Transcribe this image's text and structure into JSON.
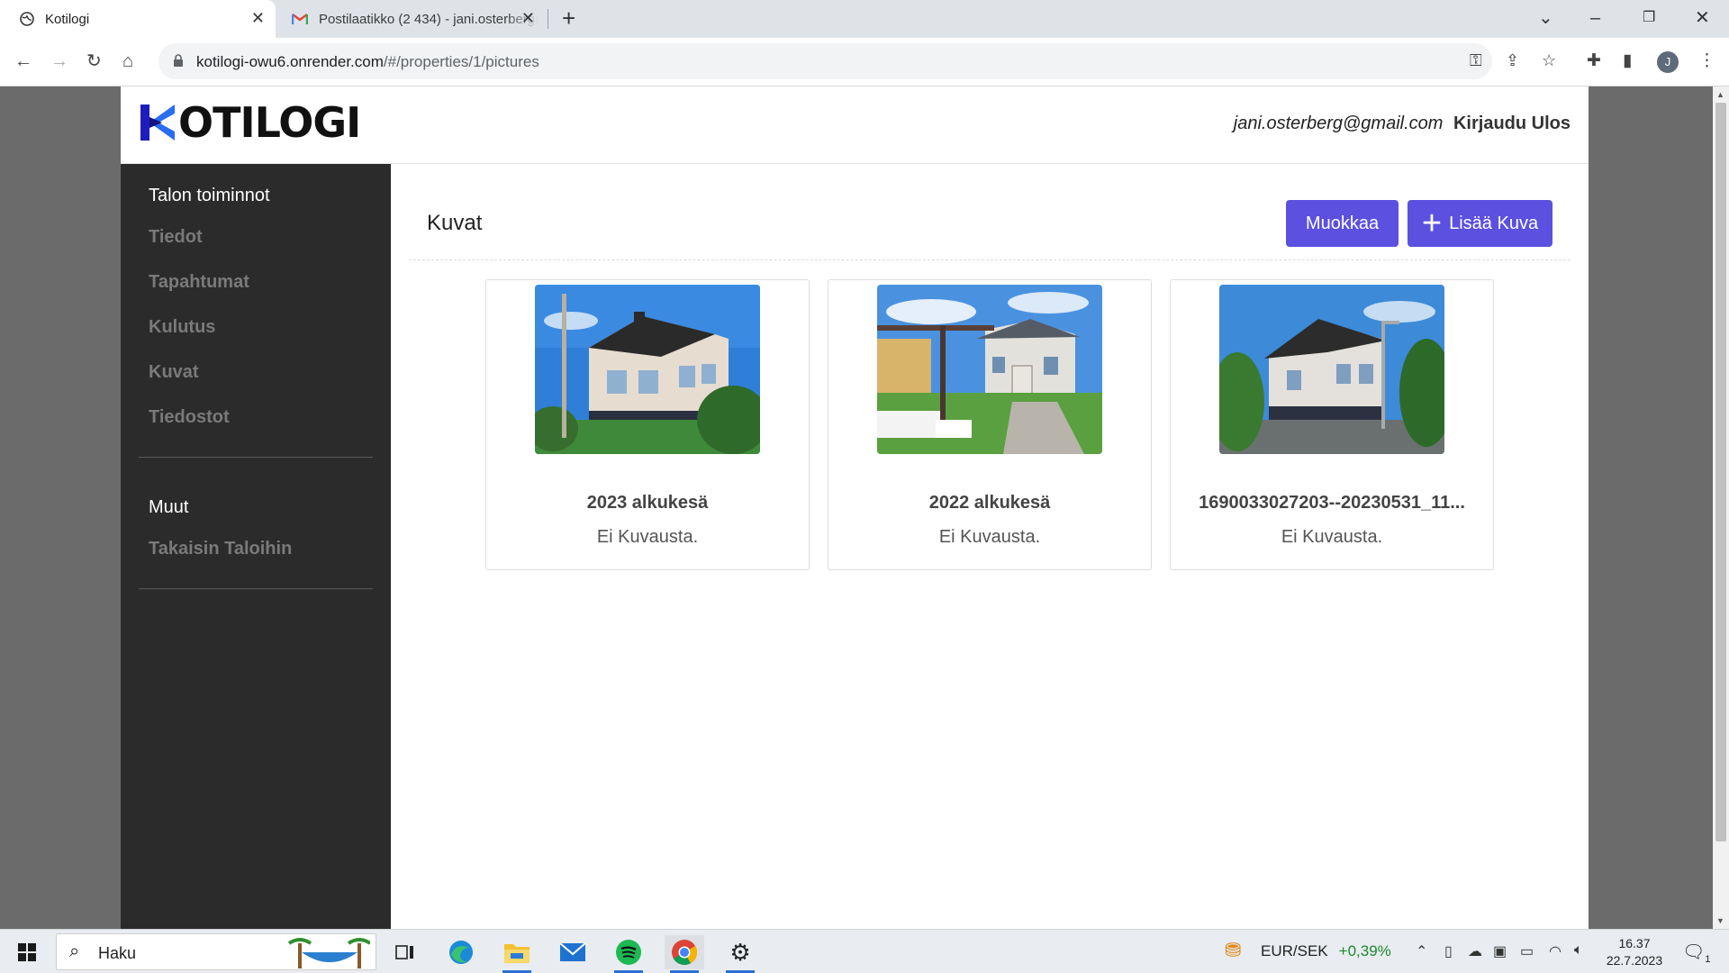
{
  "browser": {
    "tabs": [
      {
        "title": "Kotilogi",
        "active": true
      },
      {
        "title": "Postilaatikko (2 434) - jani.osterberg@gmail.com",
        "active": false
      }
    ],
    "url_host": "kotilogi-owu6.onrender.com",
    "url_path": "/#/properties/1/pictures",
    "profile_initial": "J"
  },
  "app": {
    "logo_text": "OTILOGI",
    "user_email": "jani.osterberg@gmail.com",
    "logout_label": "Kirjaudu Ulos",
    "brand_color": "#5b50e0"
  },
  "sidebar": {
    "section1_title": "Talon toiminnot",
    "section1_items": [
      "Tiedot",
      "Tapahtumat",
      "Kulutus",
      "Kuvat",
      "Tiedostot"
    ],
    "section2_title": "Muut",
    "section2_items": [
      "Takaisin Taloihin"
    ]
  },
  "page": {
    "title": "Kuvat",
    "edit_button": "Muokkaa",
    "add_button": "Lisää Kuva"
  },
  "cards": [
    {
      "title": "2023 alkukesä",
      "description": "Ei Kuvausta."
    },
    {
      "title": "2022 alkukesä",
      "description": "Ei Kuvausta."
    },
    {
      "title": "1690033027203--20230531_11...",
      "description": "Ei Kuvausta."
    }
  ],
  "taskbar": {
    "search_placeholder": "Haku",
    "ticker_label": "EUR/SEK",
    "ticker_change": "+0,39%",
    "time": "16.37",
    "date": "22.7.2023",
    "notification_count": "1"
  }
}
